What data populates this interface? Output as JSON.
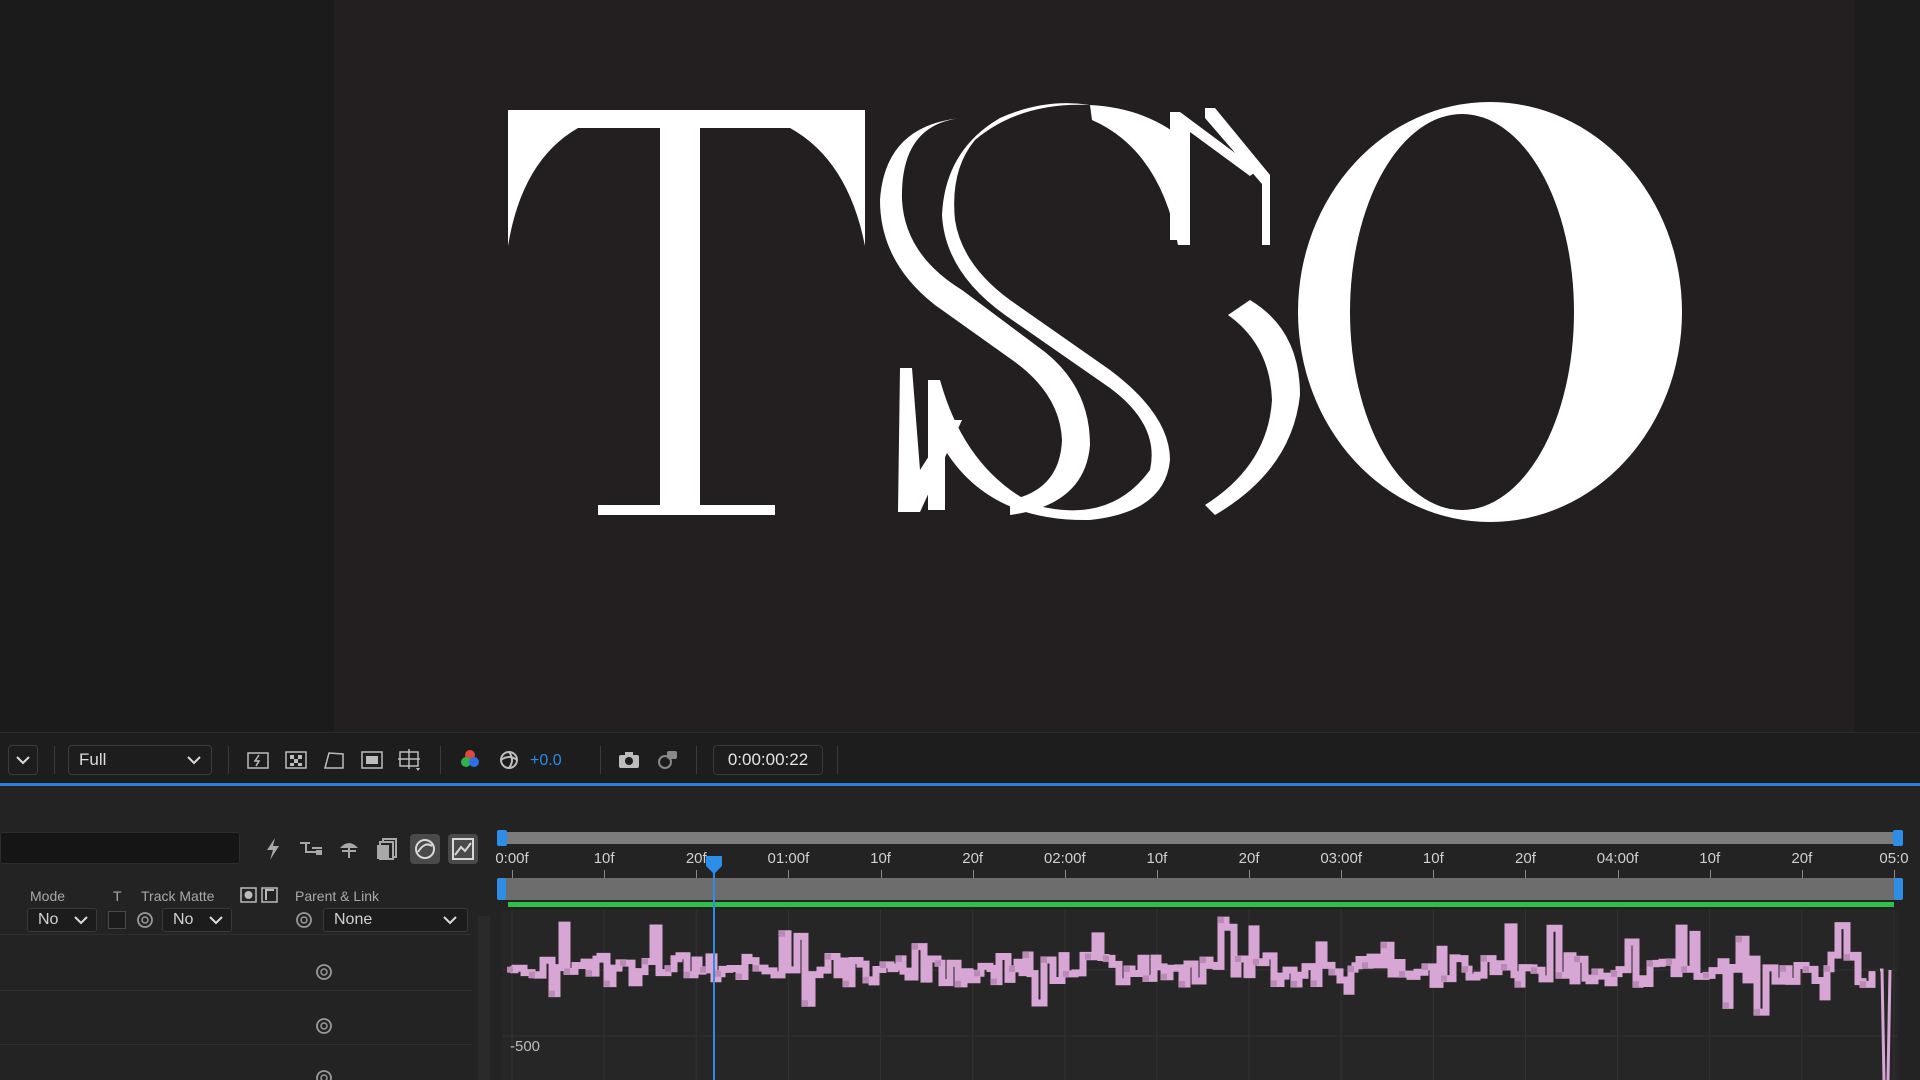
{
  "viewer": {
    "composition_text": "TSO",
    "resolution": "Full",
    "exposure": "+0.0",
    "current_time": "0:00:00:22"
  },
  "colors": {
    "comp_background": "#231f20",
    "accent_blue": "#2d8ceb",
    "keyframe_pink": "#d8a6d4",
    "work_area_green": "#2fc24a"
  },
  "icons": {
    "viewer_menu": "chevron-down-icon",
    "fast_previews": "fast-previews-icon",
    "transparency_grid": "transparency-grid-icon",
    "mask_visibility": "mask-visibility-icon",
    "region_of_interest": "region-of-interest-icon",
    "guides": "grid-guides-icon",
    "channels": "rgb-channels-icon",
    "color_management": "color-management-icon",
    "snapshot": "camera-icon",
    "show_snapshot": "show-snapshot-icon"
  },
  "timeline": {
    "columns": {
      "mode": "Mode",
      "t": "T",
      "track_matte": "Track Matte",
      "parent_link": "Parent & Link"
    },
    "layer": {
      "mode_value": "No",
      "matte_value": "No",
      "parent_value": "None"
    },
    "ruler_labels": [
      "0:00f",
      "10f",
      "20f",
      "01:00f",
      "10f",
      "20f",
      "02:00f",
      "10f",
      "20f",
      "03:00f",
      "10f",
      "20f",
      "04:00f",
      "10f",
      "20f",
      "05:0"
    ],
    "graph_value_label": "-500",
    "current_frame": 22,
    "fps": 30,
    "duration_seconds": 5
  }
}
